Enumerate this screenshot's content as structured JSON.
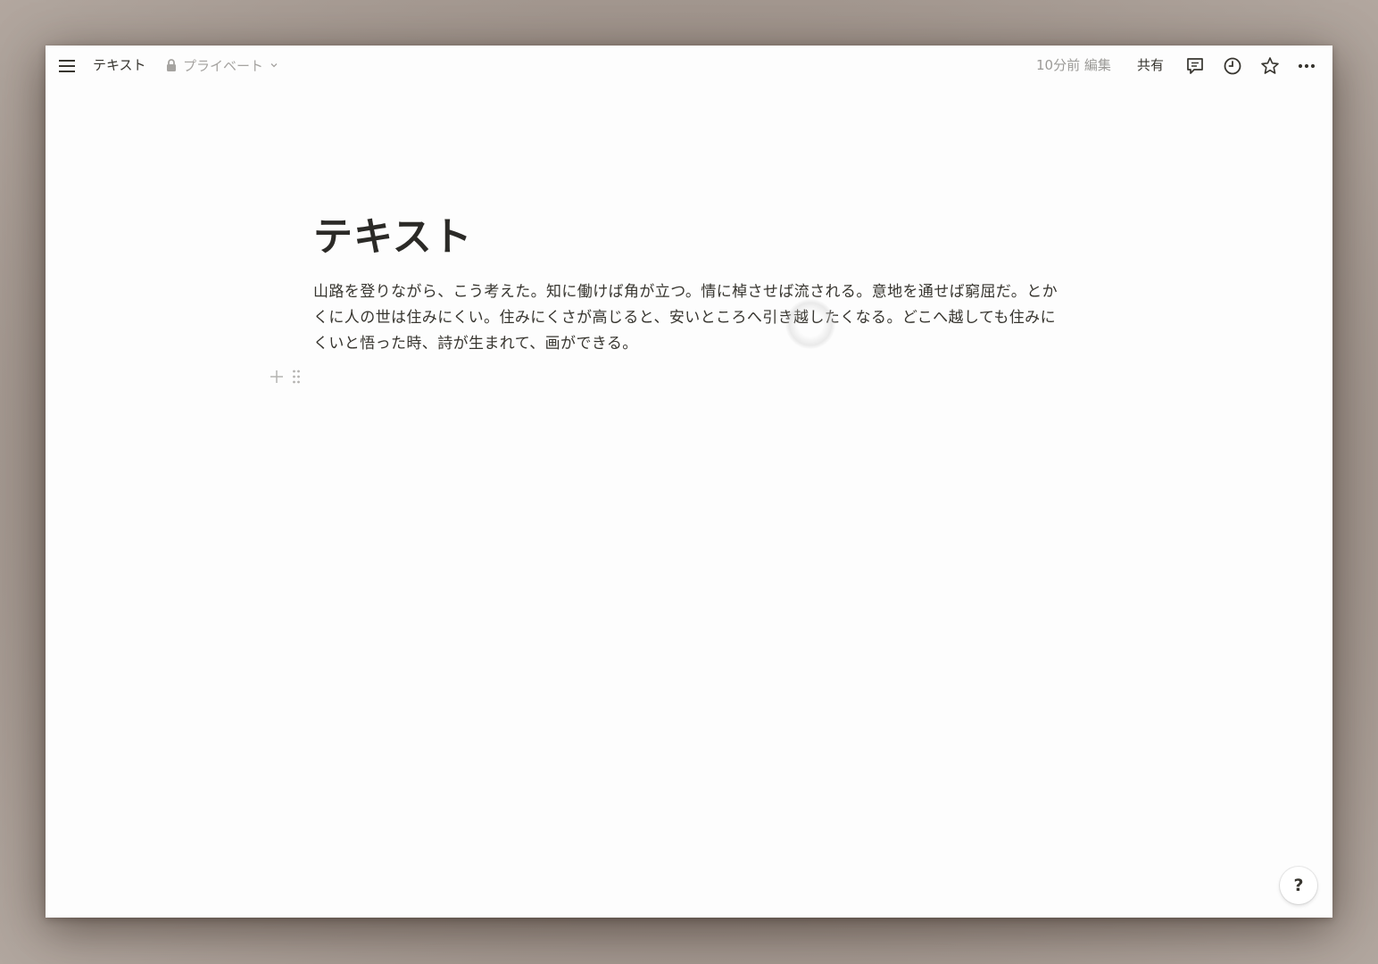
{
  "topbar": {
    "page_name": "テキスト",
    "privacy_label": "プライベート",
    "edited_label": "10分前 編集",
    "share_label": "共有",
    "icons": [
      "menu-icon",
      "lock-icon",
      "chevron-down-icon",
      "comment-icon",
      "clock-icon",
      "star-icon",
      "more-icon"
    ]
  },
  "page": {
    "title": "テキスト",
    "paragraph": "山路を登りながら、こう考えた。知に働けば角が立つ。情に棹させば流される。意地を通せば窮屈だ。とかくに人の世は住みにくい。住みにくさが高じると、安いところへ引き越したくなる。どこへ越しても住みにくいと悟った時、詩が生まれて、画ができる。"
  },
  "block_controls": {
    "icons": [
      "plus-icon",
      "drag-handle-icon"
    ]
  },
  "help": {
    "label": "?"
  },
  "colors": {
    "text": "#37352f",
    "muted": "#9b9a97",
    "background": "#fdfdfd"
  }
}
